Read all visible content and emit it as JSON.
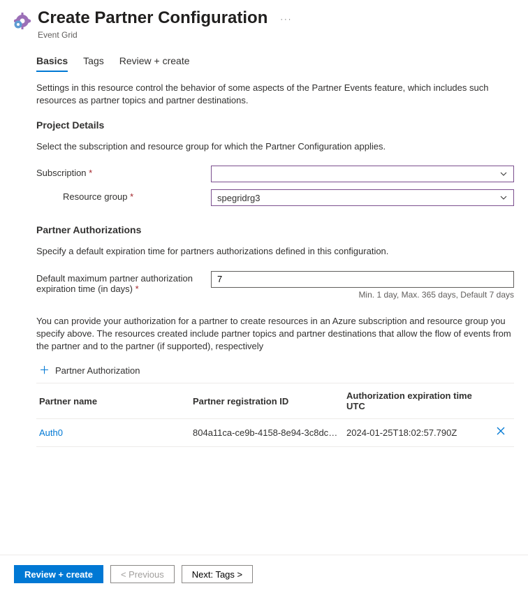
{
  "header": {
    "title": "Create Partner Configuration",
    "subtitle": "Event Grid",
    "more": "···"
  },
  "tabs": {
    "basics": "Basics",
    "tags": "Tags",
    "review": "Review + create"
  },
  "intro": "Settings in this resource control the behavior of some aspects of the Partner Events feature, which includes such resources as partner topics and partner destinations.",
  "projectDetails": {
    "heading": "Project Details",
    "desc": "Select the subscription and resource group for which the Partner Configuration applies.",
    "subscriptionLabel": "Subscription",
    "subscriptionValue": "",
    "resourceGroupLabel": "Resource group",
    "resourceGroupValue": "spegridrg3"
  },
  "partnerAuth": {
    "heading": "Partner Authorizations",
    "desc": "Specify a default expiration time for partners authorizations defined in this configuration.",
    "expirationLabel": "Default maximum partner authorization expiration time (in days)",
    "expirationValue": "7",
    "expirationHint": "Min. 1 day, Max. 365 days, Default 7 days",
    "info": "You can provide your authorization for a partner to create resources in an Azure subscription and resource group you specify above. The resources created include partner topics and partner destinations that allow the flow of events from the partner and to the partner (if supported), respectively",
    "addLabel": "Partner Authorization",
    "table": {
      "col1": "Partner name",
      "col2": "Partner registration ID",
      "col3": "Authorization expiration time UTC",
      "rows": [
        {
          "name": "Auth0",
          "regId": "804a11ca-ce9b-4158-8e94-3c8dc7…",
          "exp": "2024-01-25T18:02:57.790Z"
        }
      ]
    }
  },
  "footer": {
    "review": "Review + create",
    "prev": "< Previous",
    "next": "Next: Tags >"
  },
  "asterisk": "*"
}
